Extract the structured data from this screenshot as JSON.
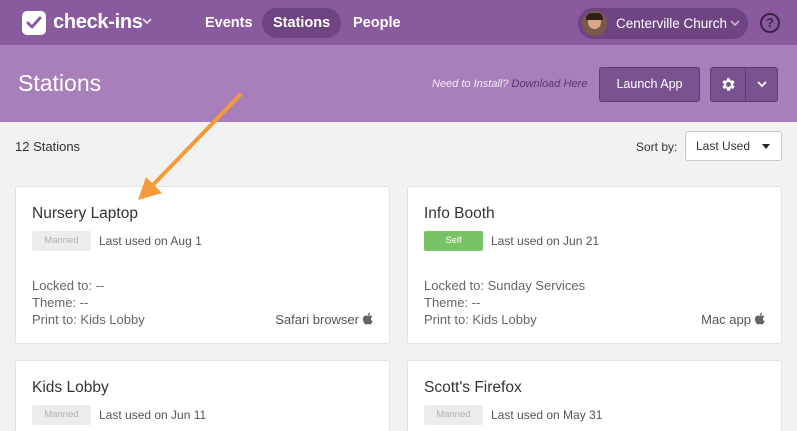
{
  "nav": {
    "brand": "check-ins",
    "items": [
      "Events",
      "Stations",
      "People"
    ],
    "active": "Stations",
    "org": "Centerville Church",
    "help": "?"
  },
  "header": {
    "title": "Stations",
    "install_prefix": "Need to Install?",
    "install_link": "Download Here",
    "launch_label": "Launch App"
  },
  "toolbar": {
    "count": "12 Stations",
    "sort_label": "Sort by:",
    "sort_value": "Last Used"
  },
  "stations": [
    {
      "name": "Nursery Laptop",
      "badge": "Manned",
      "last_used": "Last used on Aug 1",
      "locked": "Locked to: --",
      "theme": "Theme: --",
      "print": "Print to: Kids Lobby",
      "client": "Safari browser"
    },
    {
      "name": "Info Booth",
      "badge": "Self",
      "last_used": "Last used on Jun 21",
      "locked": "Locked to: Sunday Services",
      "theme": "Theme: --",
      "print": "Print to: Kids Lobby",
      "client": "Mac app"
    },
    {
      "name": "Kids Lobby",
      "badge": "Manned",
      "last_used": "Last used on Jun 11"
    },
    {
      "name": "Scott's Firefox",
      "badge": "Manned",
      "last_used": "Last used on May 31"
    }
  ],
  "colors": {
    "nav": "#8a5a9e",
    "header": "#a87fbb",
    "button": "#7b5290",
    "self_badge": "#78c366",
    "arrow": "#f39a3b"
  },
  "icons": [
    "check-icon",
    "chevron-down-icon",
    "avatar",
    "help-icon",
    "gear-icon",
    "apple-icon",
    "arrow-annotation"
  ]
}
